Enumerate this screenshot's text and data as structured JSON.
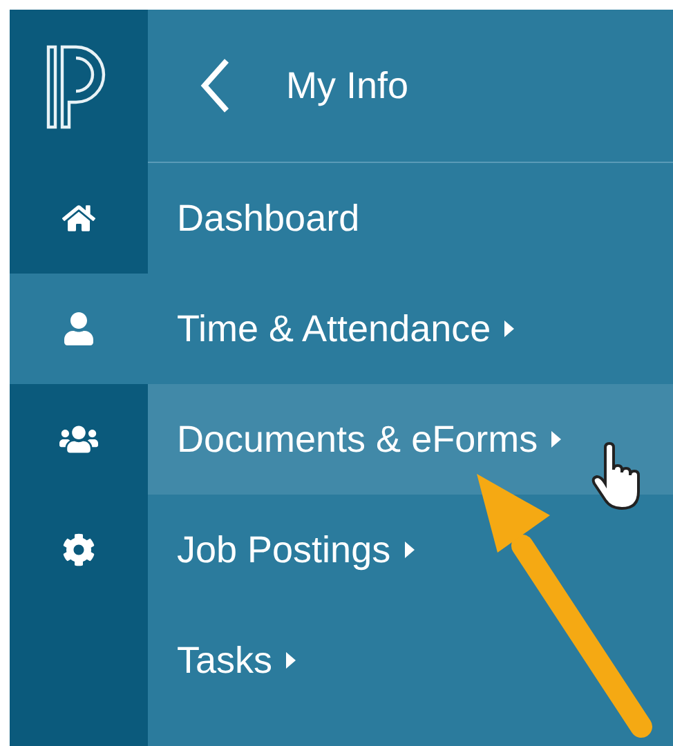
{
  "header": {
    "title": "My Info"
  },
  "rail": [
    {
      "kind": "home",
      "selected": false
    },
    {
      "kind": "person",
      "selected": true
    },
    {
      "kind": "group",
      "selected": false
    },
    {
      "kind": "gear",
      "selected": false
    }
  ],
  "menu": [
    {
      "label": "Dashboard",
      "submenu": false,
      "hovered": false
    },
    {
      "label": "Time & Attendance",
      "submenu": true,
      "hovered": false
    },
    {
      "label": "Documents & eForms",
      "submenu": true,
      "hovered": true
    },
    {
      "label": "Job Postings",
      "submenu": true,
      "hovered": false
    },
    {
      "label": "Tasks",
      "submenu": true,
      "hovered": false
    }
  ]
}
